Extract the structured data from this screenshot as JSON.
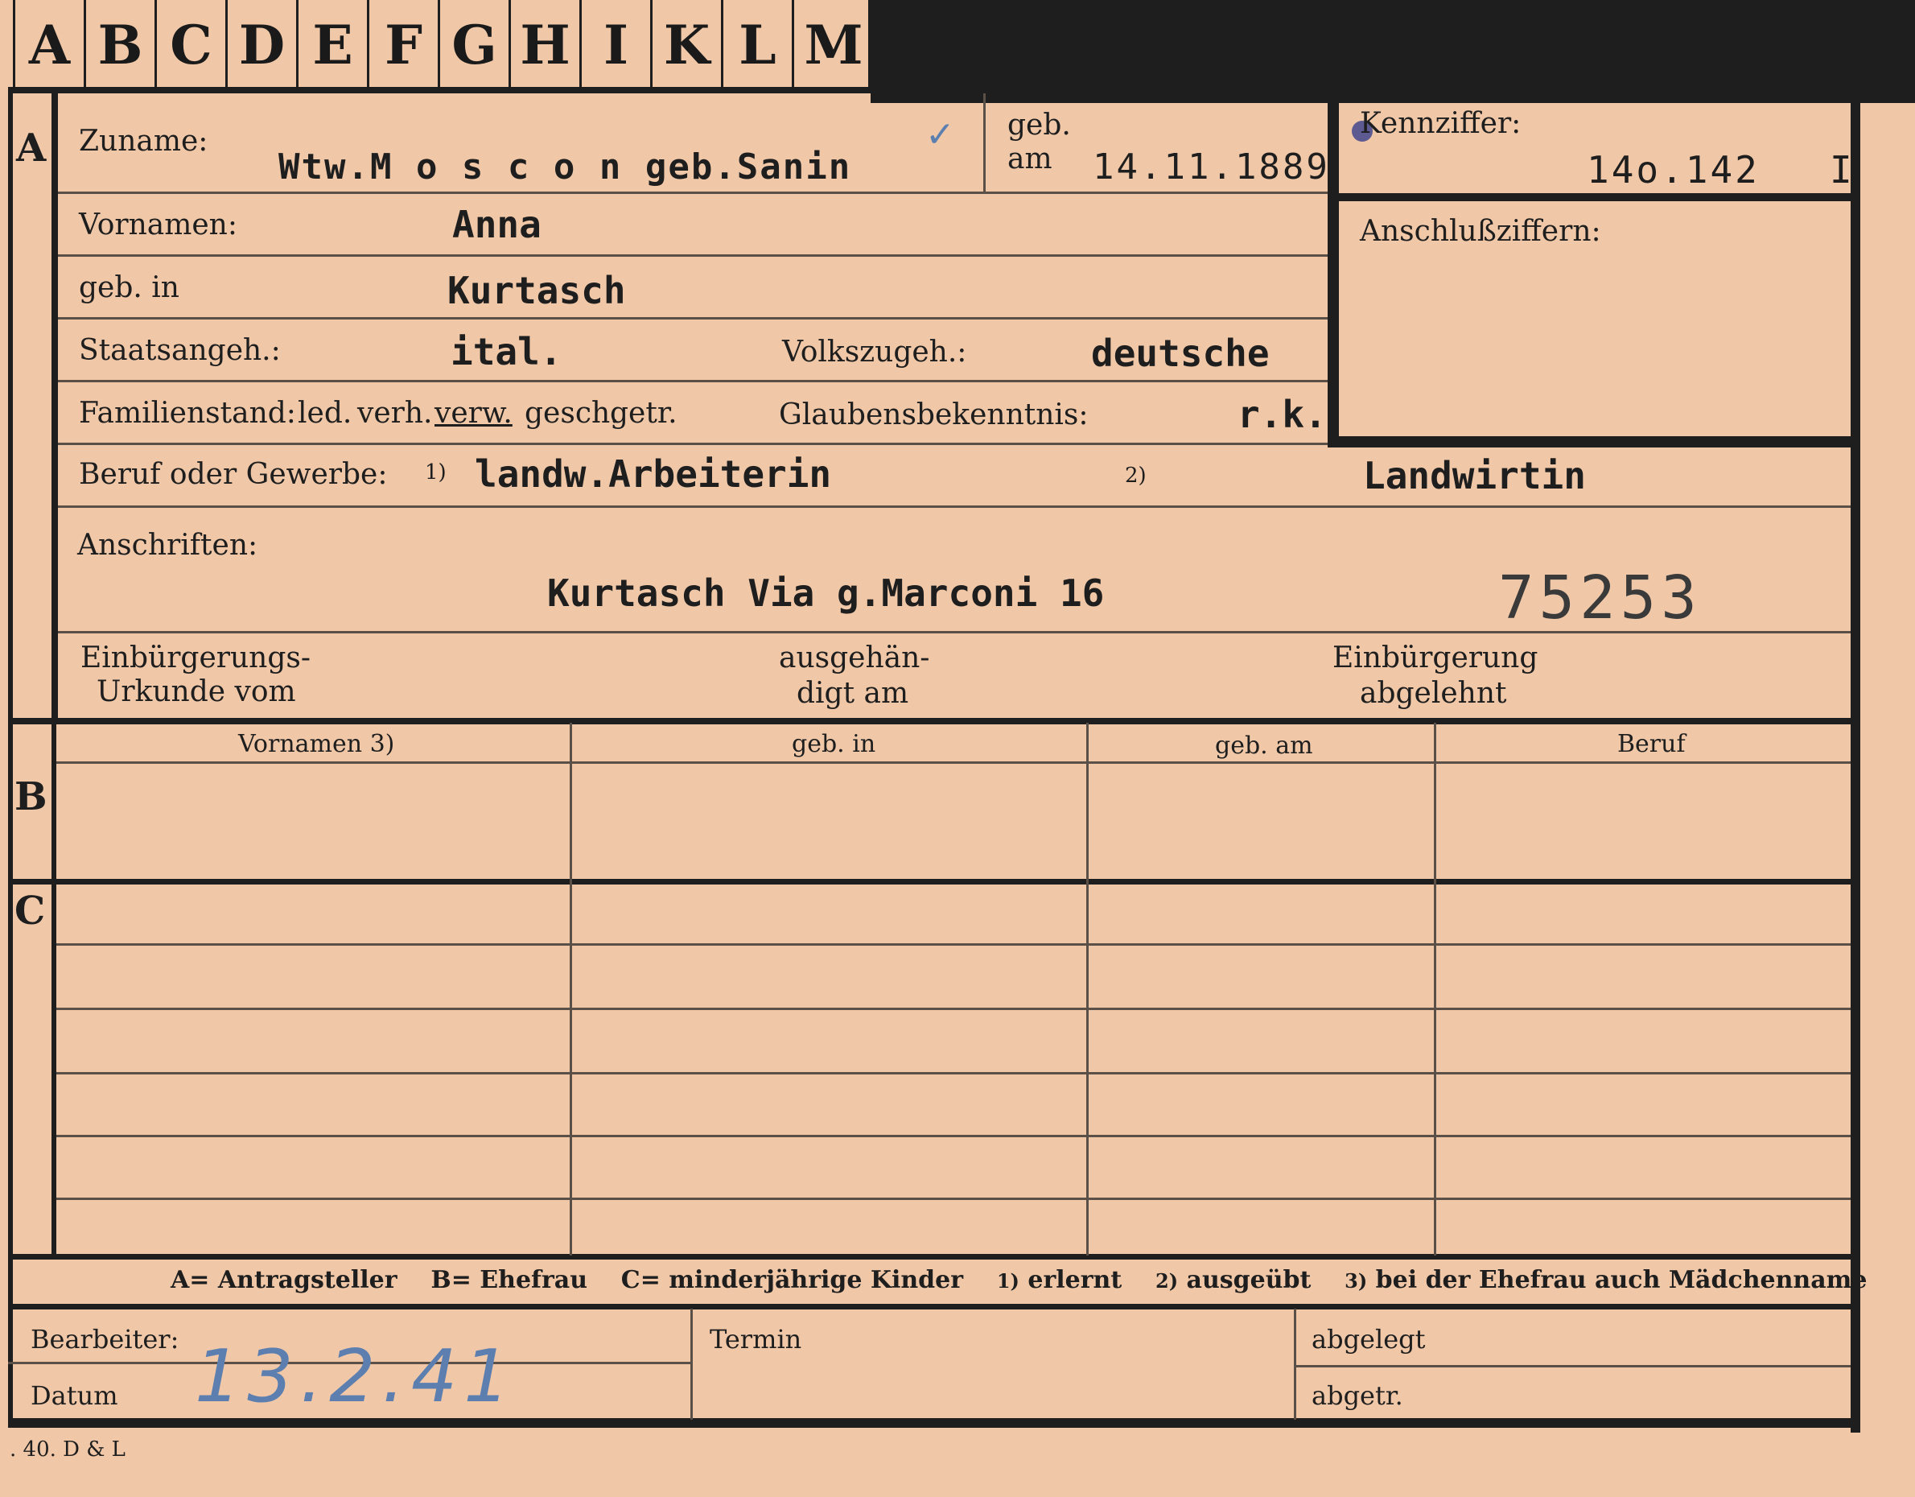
{
  "index_tabs": [
    "A",
    "B",
    "C",
    "D",
    "E",
    "F",
    "G",
    "H",
    "I",
    "K",
    "L",
    "M"
  ],
  "section_a": {
    "marker": "A",
    "surname": {
      "label": "Zuname:",
      "value": "Wtw.M o s c o n  geb.Sanin"
    },
    "born_on": {
      "label_geb": "geb.",
      "label_am": "am",
      "value": "14.11.1889"
    },
    "id_number": {
      "label": "Kennziffer:",
      "value": "14o.142",
      "suffix": "I"
    },
    "first_names": {
      "label": "Vornamen:",
      "value": "Anna"
    },
    "born_in": {
      "label": "geb. in",
      "value": "Kurtasch"
    },
    "nationality": {
      "label": "Staatsangeh.:",
      "value": "ital."
    },
    "ethnicity": {
      "label": "Volkszugeh.:",
      "value": "deutsche"
    },
    "connection_numbers": {
      "label": "Anschlußziffern:"
    },
    "marital_status": {
      "label": "Familienstand:",
      "options": [
        "led.",
        "verh.",
        "verw.",
        "gesch.",
        "getr."
      ],
      "selected": "verw."
    },
    "religion": {
      "label": "Glaubensbekenntnis:",
      "value": "r.k."
    },
    "occupation": {
      "label": "Beruf oder Gewerbe:",
      "note1": "1)",
      "value1": "landw.Arbeiterin",
      "note2": "2)",
      "value2": "Landwirtin"
    },
    "addresses": {
      "label": "Anschriften:",
      "value": "Kurtasch Via g.Marconi 16",
      "stamp": "75253"
    },
    "naturalization_certificate": {
      "label_line1": "Einbürgerungs-",
      "label_line2": "Urkunde vom"
    },
    "handed_out": {
      "label_line1": "ausgehän-",
      "label_line2": "digt am"
    },
    "naturalization_refused": {
      "label_line1": "Einbürgerung",
      "label_line2": "abgelehnt"
    }
  },
  "section_b": {
    "marker": "B",
    "columns": [
      "Vornamen 3)",
      "geb. in",
      "geb. am",
      "Beruf"
    ]
  },
  "section_c": {
    "marker": "C"
  },
  "legend": [
    {
      "key": "A",
      "text": "= Antragsteller"
    },
    {
      "key": "B",
      "text": "= Ehefrau"
    },
    {
      "key": "C",
      "text": "= minderjährige Kinder"
    },
    {
      "key": "1)",
      "text": "erlernt"
    },
    {
      "key": "2)",
      "text": "ausgeübt"
    },
    {
      "key": "3)",
      "text": "bei der Ehefrau auch Mädchenname"
    }
  ],
  "footer": {
    "processor_label": "Bearbeiter:",
    "date_label": "Datum",
    "date_value": "13.2.41",
    "deadline_label": "Termin",
    "filed_label": "abgelegt",
    "separated_label": "abgetr."
  },
  "print_mark": ". 40. D & L",
  "colors": {
    "card": "#f0c8a8",
    "ink": "#1e1e1e",
    "handwriting": "#5c7fb0"
  }
}
